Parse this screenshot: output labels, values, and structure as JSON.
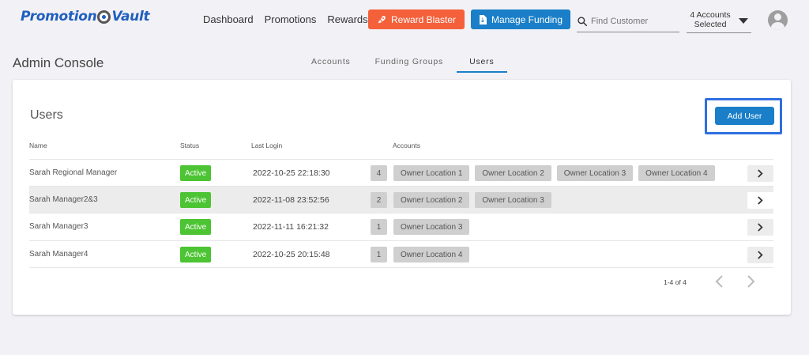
{
  "header": {
    "logo_text_left": "Promotion",
    "logo_text_right": "Vault",
    "nav": [
      "Dashboard",
      "Promotions",
      "Rewards"
    ],
    "reward_button": "Reward Blaster",
    "funding_button": "Manage Funding",
    "search_placeholder": "Find Customer",
    "accounts_line1": "4 Accounts",
    "accounts_line2": "Selected"
  },
  "page": {
    "title": "Admin Console",
    "tabs": [
      {
        "label": "Accounts",
        "active": false
      },
      {
        "label": "Funding Groups",
        "active": false
      },
      {
        "label": "Users",
        "active": true
      }
    ]
  },
  "users": {
    "title": "Users",
    "add_button": "Add User",
    "columns": {
      "name": "Name",
      "status": "Status",
      "last_login": "Last Login",
      "accounts": "Accounts"
    },
    "rows": [
      {
        "name": "Sarah Regional Manager",
        "status": "Active",
        "last_login": "2022-10-25 22:18:30",
        "count": "4",
        "accounts": [
          "Owner Location 1",
          "Owner Location 2",
          "Owner Location 3",
          "Owner Location 4"
        ]
      },
      {
        "name": "Sarah Manager2&3",
        "status": "Active",
        "last_login": "2022-11-08 23:52:56",
        "count": "2",
        "accounts": [
          "Owner Location 2",
          "Owner Location 3"
        ]
      },
      {
        "name": "Sarah Manager3",
        "status": "Active",
        "last_login": "2022-11-11 16:21:32",
        "count": "1",
        "accounts": [
          "Owner Location 3"
        ]
      },
      {
        "name": "Sarah Manager4",
        "status": "Active",
        "last_login": "2022-10-25 20:15:48",
        "count": "1",
        "accounts": [
          "Owner Location 4"
        ]
      }
    ],
    "pager": "1-4 of 4"
  },
  "colors": {
    "brand_blue": "#1a7fc8",
    "reward_orange": "#f4603a",
    "active_green": "#4cc433",
    "highlight_border": "#2f6fe0"
  },
  "icons": {
    "reward": "rocket-icon",
    "funding": "document-icon",
    "search": "search-icon",
    "dropdown": "caret-down-icon",
    "avatar": "user-avatar-icon",
    "row_action": "chevron-right-icon",
    "pager_prev": "chevron-left-icon",
    "pager_next": "chevron-right-icon"
  }
}
